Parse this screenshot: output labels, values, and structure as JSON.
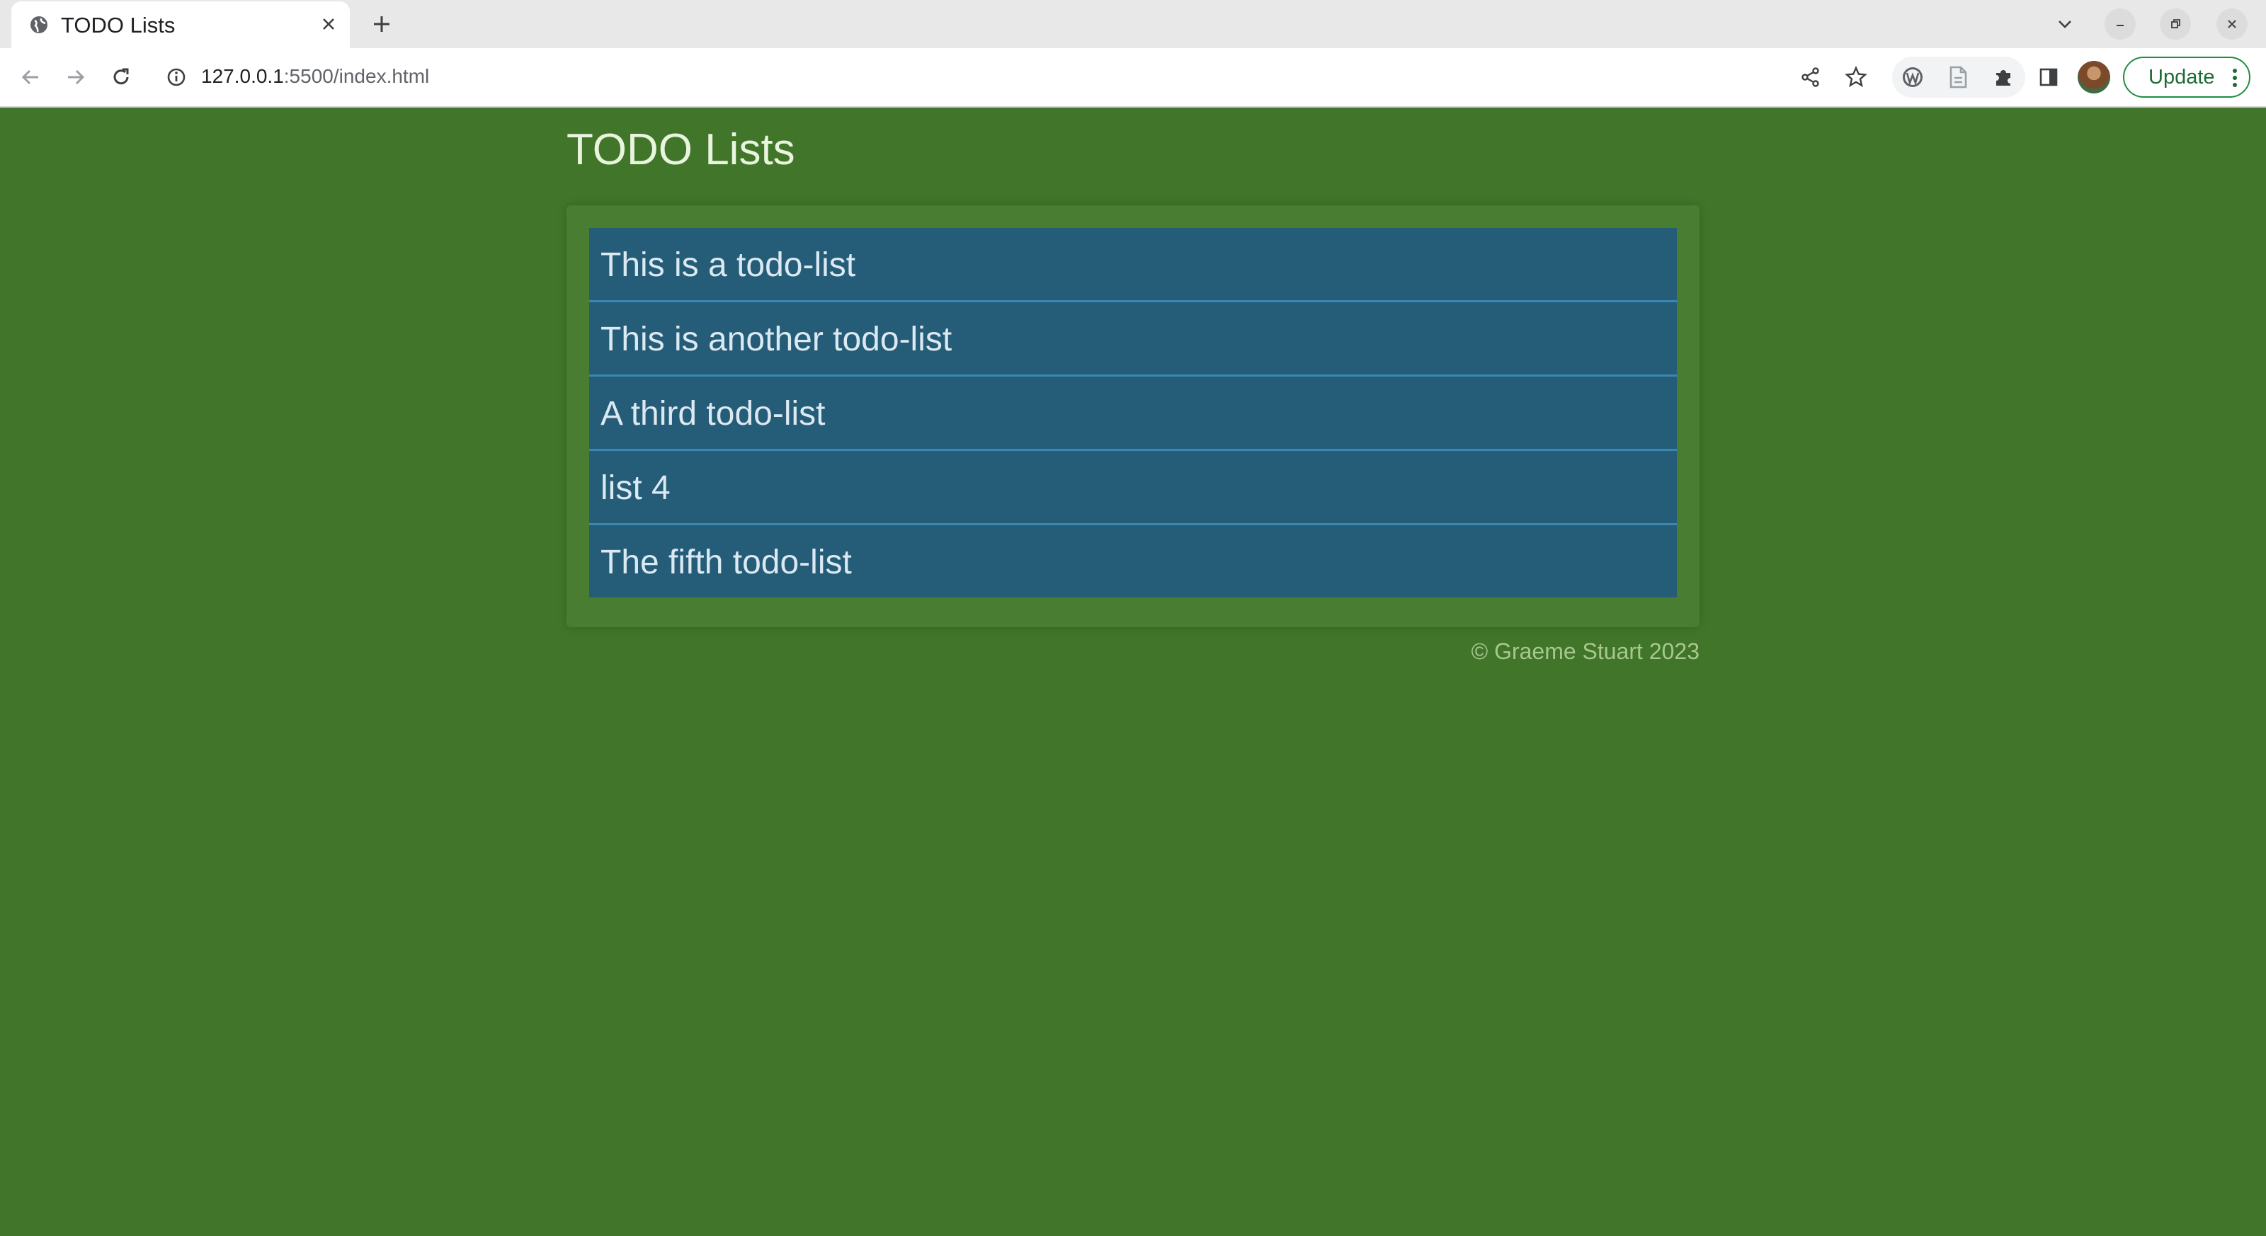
{
  "browser": {
    "tab": {
      "title": "TODO Lists",
      "favicon": "globe-icon",
      "close_icon": "close-icon"
    },
    "new_tab_icon": "plus-icon",
    "window_controls": [
      "chevron-down-icon",
      "minimize-icon",
      "restore-icon",
      "close-icon"
    ],
    "toolbar": {
      "nav_icons": [
        "back-arrow-icon",
        "forward-arrow-icon",
        "reload-icon"
      ],
      "info_icon": "info-icon",
      "url_host": "127.0.0.1",
      "url_rest": ":5500/index.html",
      "action_icons": [
        "share-icon",
        "star-icon"
      ],
      "extension_icons": [
        "wordpress-icon",
        "document-icon",
        "puzzle-icon"
      ],
      "sidepanel_icon": "side-panel-icon",
      "avatar": "profile-avatar",
      "update_label": "Update",
      "menu_icon": "kebab-menu-icon"
    }
  },
  "page": {
    "title": "TODO Lists",
    "lists": [
      "This is a todo-list",
      "This is another todo-list",
      "A third todo-list",
      "list 4",
      "The fifth todo-list"
    ],
    "footer": "© Graeme Stuart 2023"
  },
  "colors": {
    "page_background": "#41762a",
    "card_background": "#497d32",
    "list_item_background": "#255c77",
    "list_item_divider": "#3a88b2",
    "title_text": "#e9f4df",
    "footer_text": "#a6c88f",
    "update_accent": "#1e8e3e"
  }
}
